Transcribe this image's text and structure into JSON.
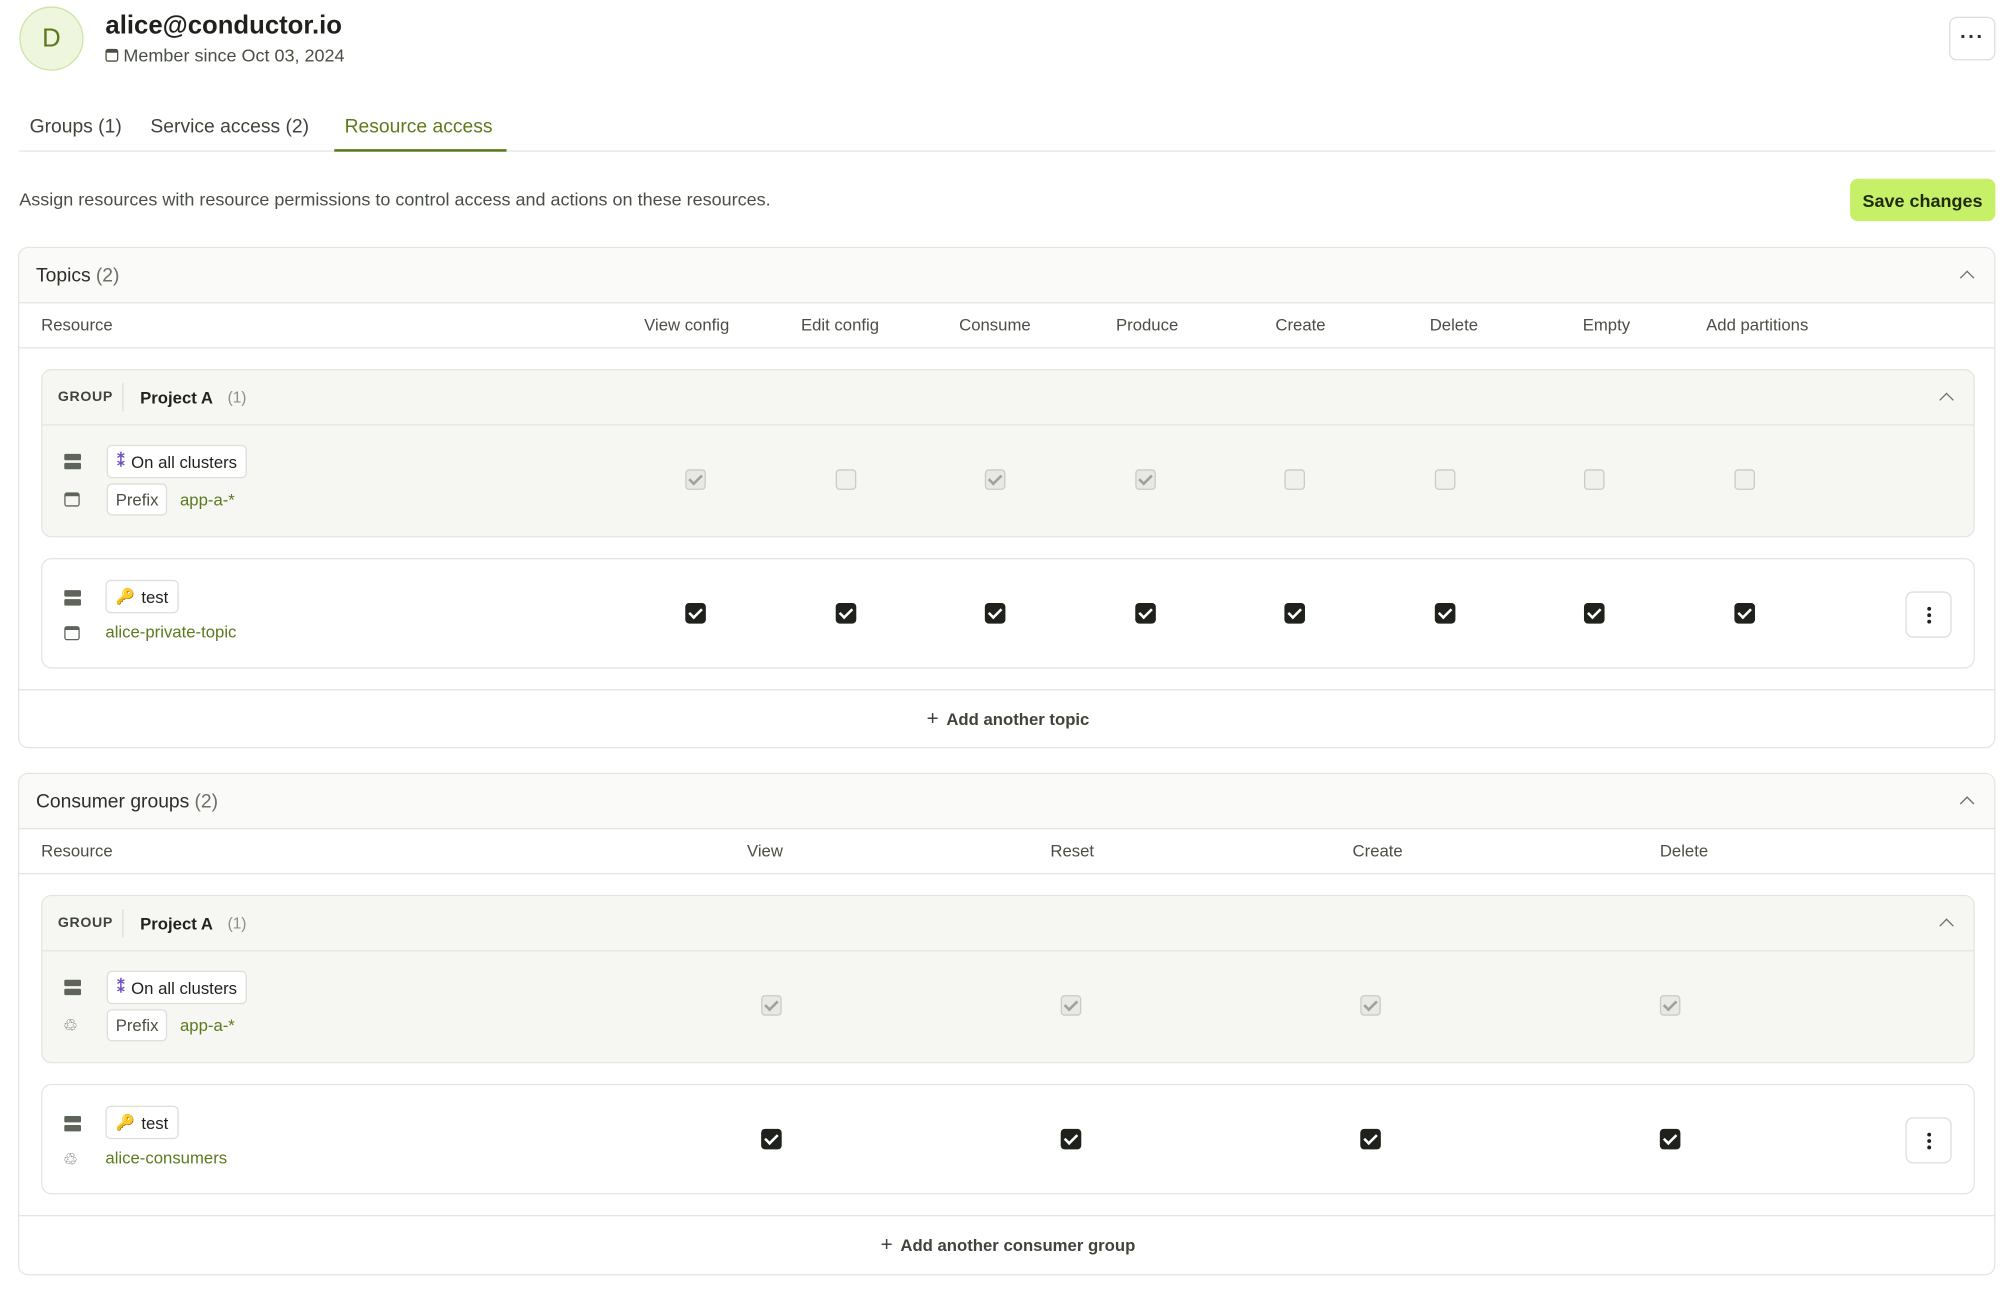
{
  "user": {
    "avatar_initial": "D",
    "email": "alice@conductor.io",
    "member_since": "Member since Oct 03, 2024"
  },
  "tabs": [
    {
      "label": "Groups (1)",
      "active": false
    },
    {
      "label": "Service access (2)",
      "active": false
    },
    {
      "label": "Resource access",
      "active": true
    }
  ],
  "description": "Assign resources with resource permissions to control access and actions on these resources.",
  "save_label": "Save changes",
  "topics": {
    "title": "Topics",
    "count": "(2)",
    "columns": [
      "Resource",
      "View config",
      "Edit config",
      "Consume",
      "Produce",
      "Create",
      "Delete",
      "Empty",
      "Add partitions"
    ],
    "group": {
      "tag": "GROUP",
      "name": "Project A",
      "count": "(1)",
      "cluster_label": "On all clusters",
      "prefix_label": "Prefix",
      "resource": "app-a-*",
      "permissions": [
        true,
        false,
        true,
        true,
        false,
        false,
        false,
        false
      ]
    },
    "resource": {
      "cluster_label": "test",
      "resource": "alice-private-topic",
      "permissions": [
        true,
        true,
        true,
        true,
        true,
        true,
        true,
        true
      ]
    },
    "add_label": "Add another topic"
  },
  "consumer_groups": {
    "title": "Consumer groups",
    "count": "(2)",
    "columns": [
      "Resource",
      "View",
      "Reset",
      "Create",
      "Delete"
    ],
    "group": {
      "tag": "GROUP",
      "name": "Project A",
      "count": "(1)",
      "cluster_label": "On all clusters",
      "prefix_label": "Prefix",
      "resource": "app-a-*",
      "permissions": [
        true,
        true,
        true,
        true
      ]
    },
    "resource": {
      "cluster_label": "test",
      "resource": "alice-consumers",
      "permissions": [
        true,
        true,
        true,
        true
      ]
    },
    "add_label": "Add another consumer group"
  },
  "colors": {
    "accent": "#5c7a1c",
    "save_button": "#c6f068",
    "checkbox_checked": "#1e211c"
  },
  "icons": [
    "calendar-icon",
    "more-horizontal-icon",
    "chevron-up-icon",
    "server-icon",
    "topic-icon",
    "consumer-group-icon",
    "cluster-icon",
    "key-icon",
    "plus-icon",
    "more-vertical-icon"
  ]
}
